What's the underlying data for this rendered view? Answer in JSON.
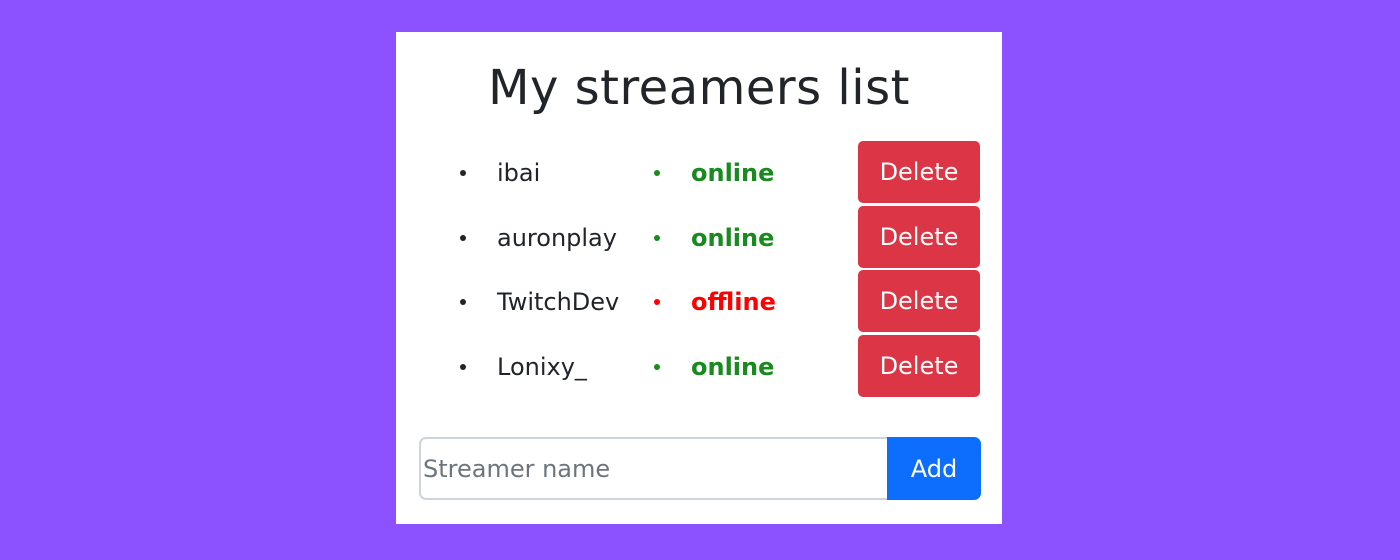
{
  "page": {
    "title": "My streamers list",
    "background_color": "#8c52ff"
  },
  "streamers": [
    {
      "name": "ibai",
      "status": "online",
      "status_color": "#198a1f",
      "delete_label": "Delete"
    },
    {
      "name": "auronplay",
      "status": "online",
      "status_color": "#198a1f",
      "delete_label": "Delete"
    },
    {
      "name": "TwitchDev",
      "status": "offline",
      "status_color": "#ff0000",
      "delete_label": "Delete"
    },
    {
      "name": "Lonixy_",
      "status": "online",
      "status_color": "#198a1f",
      "delete_label": "Delete"
    }
  ],
  "add_form": {
    "placeholder": "Streamer name",
    "value": "",
    "add_label": "Add"
  },
  "colors": {
    "delete_button": "#dc3545",
    "add_button": "#0d6efd",
    "online": "#198a1f",
    "offline": "#ff0000"
  }
}
